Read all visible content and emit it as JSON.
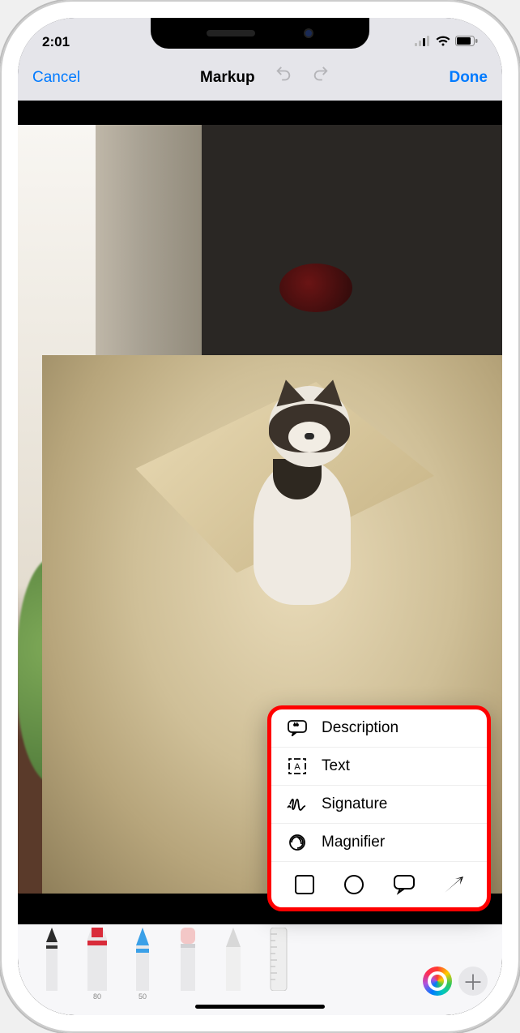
{
  "status": {
    "time": "2:01"
  },
  "nav": {
    "cancel": "Cancel",
    "title": "Markup",
    "done": "Done"
  },
  "popup": {
    "description": "Description",
    "text": "Text",
    "signature": "Signature",
    "magnifier": "Magnifier"
  },
  "tools": {
    "marker_label": "80",
    "highlighter_label": "50"
  }
}
